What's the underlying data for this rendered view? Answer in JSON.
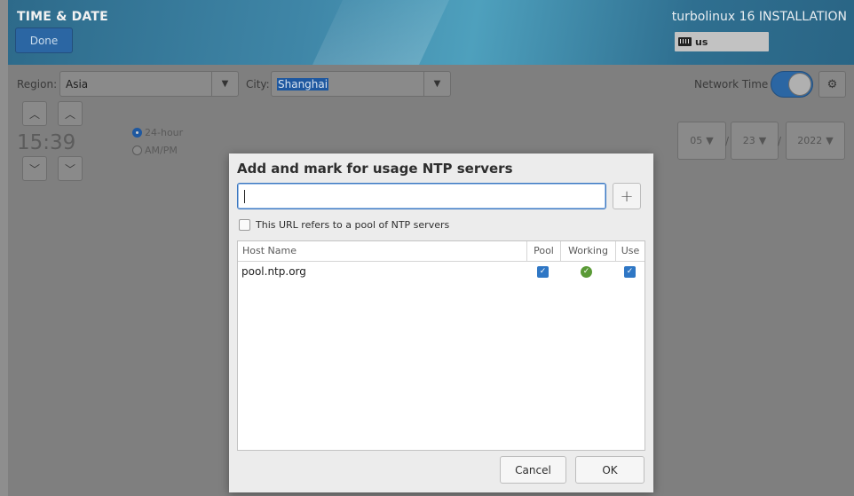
{
  "header": {
    "title": "TIME & DATE",
    "done_label": "Done",
    "install_title": "turbolinux 16 INSTALLATION",
    "keyboard_layout": "us"
  },
  "location": {
    "region_label": "Region:",
    "region_value": "Asia",
    "city_label": "City:",
    "city_value": "Shanghai"
  },
  "network_time": {
    "label": "Network Time",
    "enabled": true
  },
  "clock": {
    "time": "15:39",
    "format_24": "24-hour",
    "format_ampm": "AM/PM",
    "selected_format": "24-hour"
  },
  "date": {
    "month": "05",
    "day": "23",
    "year": "2022",
    "separator": "/"
  },
  "dialog": {
    "title": "Add and mark for usage NTP servers",
    "input_value": "",
    "add_label": "+",
    "pool_checkbox_label": "This URL refers to a pool of NTP servers",
    "columns": [
      "Host Name",
      "Pool",
      "Working",
      "Use"
    ],
    "servers": [
      {
        "host": "pool.ntp.org",
        "pool": true,
        "working": true,
        "use": true
      }
    ],
    "cancel_label": "Cancel",
    "ok_label": "OK"
  },
  "colors": {
    "accent": "#2b66a3",
    "working_ok": "#5a9a36"
  }
}
